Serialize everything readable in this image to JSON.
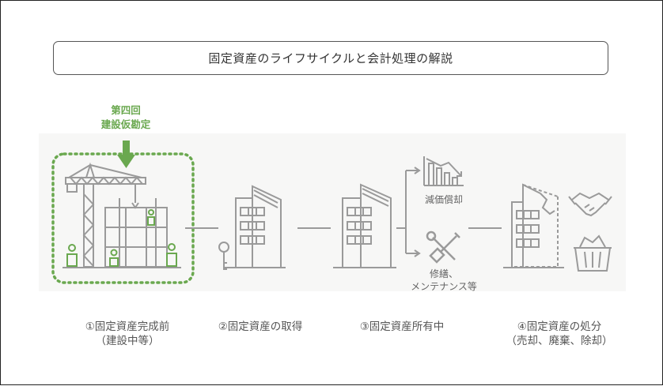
{
  "title": "固定資産のライフサイクルと会計処理の解説",
  "annotation": {
    "line1": "第四回",
    "line2": "建設仮勘定"
  },
  "branches": {
    "depreciation": "減価償却",
    "repair_line1": "修繕、",
    "repair_line2": "メンテナンス等"
  },
  "stages": [
    {
      "line1": "①固定資産完成前",
      "line2": "（建設中等）"
    },
    {
      "line1": "②固定資産の取得",
      "line2": ""
    },
    {
      "line1": "③固定資産所有中",
      "line2": ""
    },
    {
      "line1": "④固定資産の処分",
      "line2": "（売却、廃棄、除却）"
    }
  ],
  "colors": {
    "accent_green": "#6aa84f",
    "line_gray": "#9a9a9a",
    "panel_bg": "#f7f7f6"
  },
  "icons": [
    "crane-construction-icon",
    "building-key-icon",
    "building-icon",
    "declining-chart-icon",
    "wrench-screwdriver-icon",
    "demolished-building-icon",
    "handshake-icon",
    "trash-basket-icon",
    "arrow-down-icon"
  ]
}
